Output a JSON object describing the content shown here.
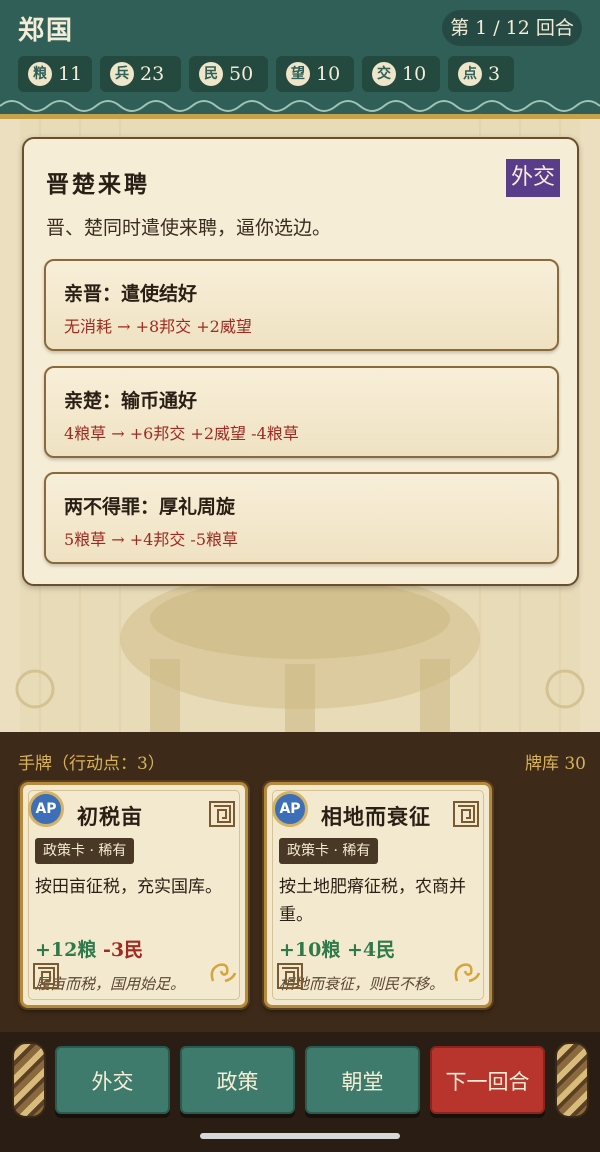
{
  "header": {
    "state_name": "郑国",
    "turn_text": "第 1 / 12 回合",
    "stats": [
      {
        "badge": "粮",
        "value": "11"
      },
      {
        "badge": "兵",
        "value": "23"
      },
      {
        "badge": "民",
        "value": "50"
      },
      {
        "badge": "望",
        "value": "10"
      },
      {
        "badge": "交",
        "value": "10"
      },
      {
        "badge": "点",
        "value": "3"
      }
    ]
  },
  "event": {
    "title": "晋楚来聘",
    "tag": "外交",
    "description": "晋、楚同时遣使来聘，逼你选边。",
    "choices": [
      {
        "title": "亲晋：遣使结好",
        "effect": "无消耗 → +8邦交 +2威望"
      },
      {
        "title": "亲楚：输币通好",
        "effect": "4粮草 → +6邦交 +2威望 -4粮草"
      },
      {
        "title": "两不得罪：厚礼周旋",
        "effect": "5粮草 → +4邦交 -5粮草"
      }
    ]
  },
  "hand": {
    "label": "手牌（行动点：3）",
    "deck_label": "牌库 30",
    "cards": [
      {
        "ap": "AP",
        "title": "初税亩",
        "type": "政策卡 · 稀有",
        "description": "按田亩征税，充实国库。",
        "effect_pos": "+12粮",
        "effect_neg": "-3民",
        "flavor": "履亩而税，国用始足。"
      },
      {
        "ap": "AP",
        "title": "相地而衰征",
        "type": "政策卡 · 稀有",
        "description": "按土地肥瘠征税，农商并重。",
        "effect_pos": "+10粮",
        "effect_neg": "+4民",
        "flavor": "相地而衰征，则民不移。"
      }
    ]
  },
  "buttons": {
    "diplomacy": "外交",
    "policy": "政策",
    "court": "朝堂",
    "next_turn": "下一回合"
  },
  "colors": {
    "header_green": "#2f5f56",
    "parchment": "#f6edd6",
    "gold": "#c8a24a",
    "tag_purple": "#5a3d8a",
    "effect_red": "#a02a22",
    "effect_green": "#2f7a4a",
    "button_green": "#3e7b6c",
    "button_red": "#b8352d"
  }
}
